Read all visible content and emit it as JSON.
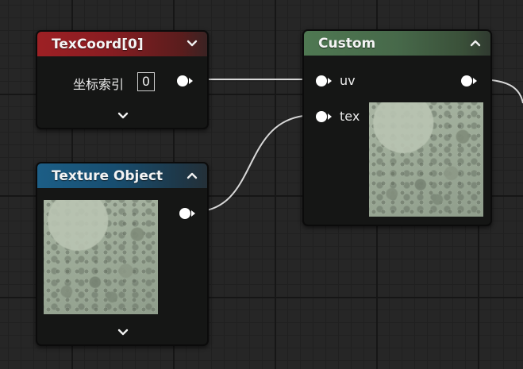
{
  "nodes": {
    "texcoord": {
      "title": "TexCoord[0]",
      "header_color": "#9d2024",
      "param_label": "坐标索引",
      "coordinate_index": "0",
      "collapse_icon": "chevron-down-icon",
      "expand_icon": "chevron-down-icon"
    },
    "texture_object": {
      "title": "Texture Object",
      "header_color": "#1c5e86",
      "collapse_icon": "chevron-up-icon",
      "expand_icon": "chevron-down-icon",
      "preview_icon": "stone-texture-preview"
    },
    "custom": {
      "title": "Custom",
      "header_color": "#4f7852",
      "collapse_icon": "chevron-up-icon",
      "inputs": [
        {
          "label": "uv"
        },
        {
          "label": "tex"
        }
      ],
      "preview_icon": "stone-texture-preview"
    }
  },
  "colors": {
    "canvas": "#262626",
    "wire": "#d8d8d8",
    "pin": "#ffffff"
  }
}
